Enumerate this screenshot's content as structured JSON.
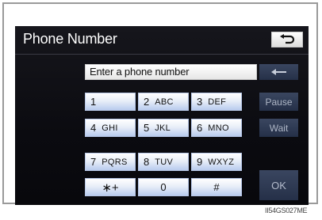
{
  "screen": {
    "title": "Phone Number",
    "back_icon": "return-arrow-icon"
  },
  "input": {
    "placeholder": "Enter a phone number",
    "backspace_icon": "left-arrow-icon"
  },
  "keypad": {
    "keys": [
      {
        "num": "1",
        "letters": ""
      },
      {
        "num": "2",
        "letters": "ABC"
      },
      {
        "num": "3",
        "letters": "DEF"
      },
      {
        "num": "4",
        "letters": "GHI"
      },
      {
        "num": "5",
        "letters": "JKL"
      },
      {
        "num": "6",
        "letters": "MNO"
      },
      {
        "num": "7",
        "letters": "PQRS"
      },
      {
        "num": "8",
        "letters": "TUV"
      },
      {
        "num": "9",
        "letters": "WXYZ"
      },
      {
        "num": "∗+",
        "letters": ""
      },
      {
        "num": "0",
        "letters": ""
      },
      {
        "num": "#",
        "letters": ""
      }
    ]
  },
  "side_buttons": {
    "pause": "Pause",
    "wait": "Wait",
    "ok": "OK"
  },
  "caption": "II54GS027ME",
  "colors": {
    "screen_bg": "#0b0b10",
    "key_light": "#ffffff",
    "key_blue": "#b9cbee",
    "side_button": "#2b3650"
  }
}
